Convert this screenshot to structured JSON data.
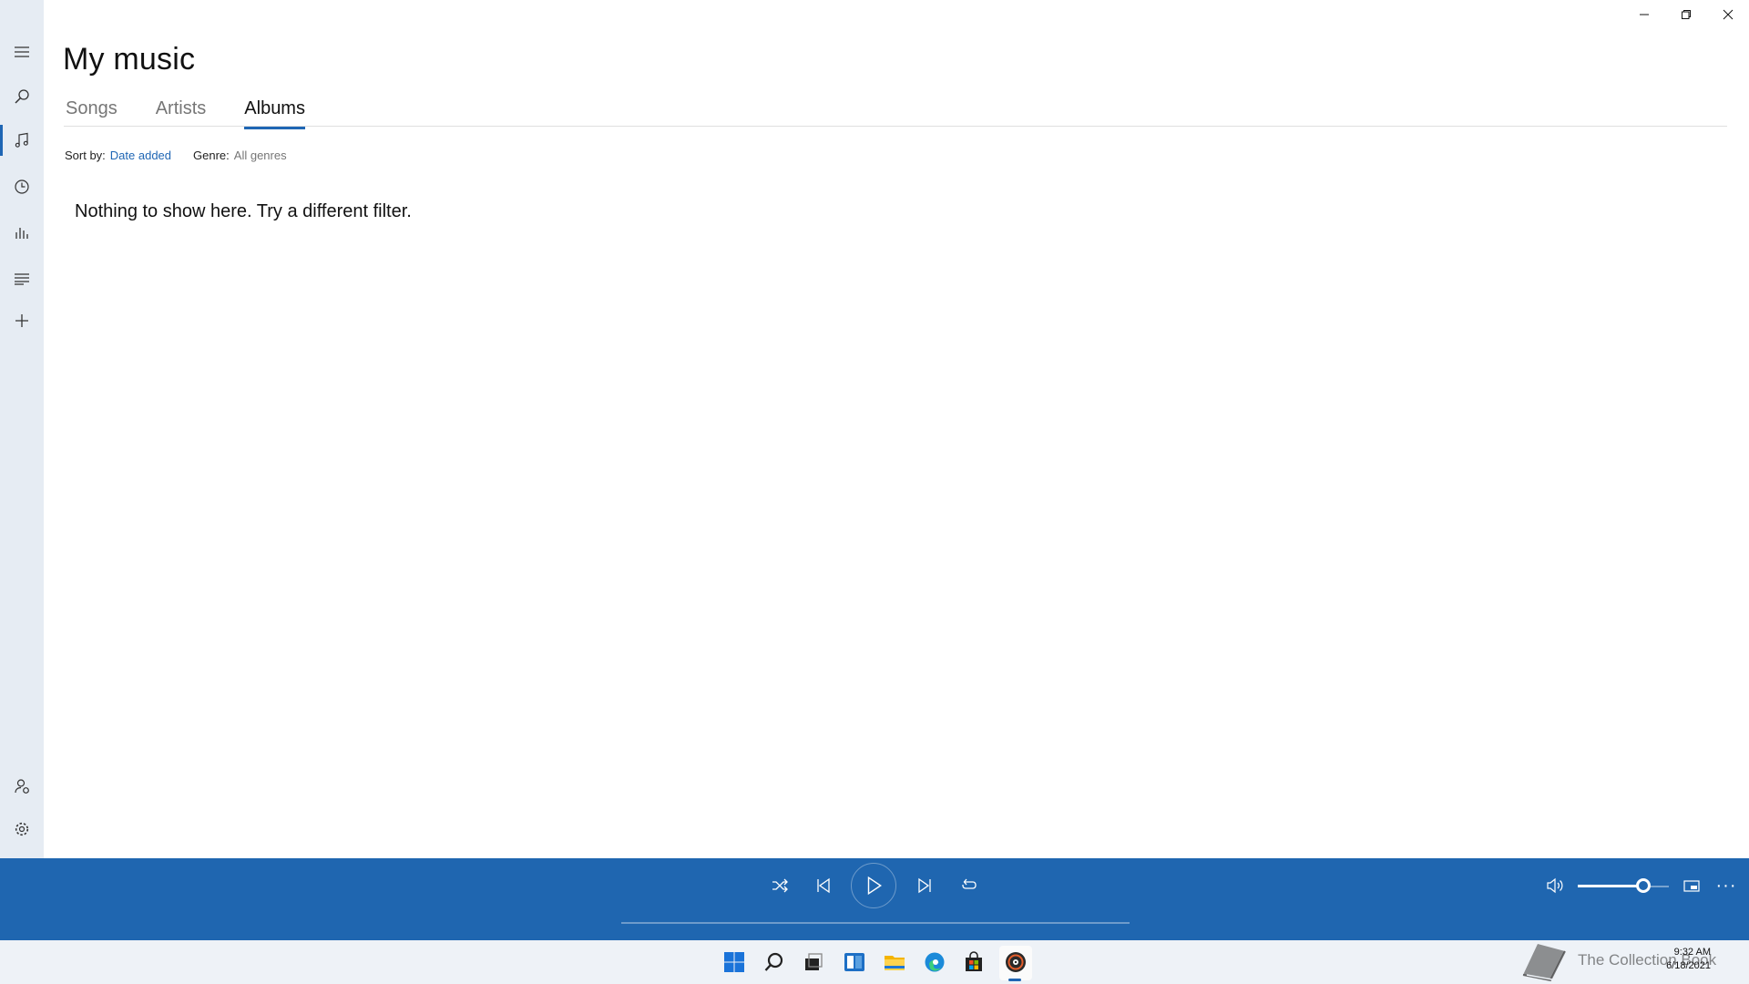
{
  "app": {
    "title": "My music",
    "tabs": [
      {
        "label": "Songs",
        "active": false
      },
      {
        "label": "Artists",
        "active": false
      },
      {
        "label": "Albums",
        "active": true
      }
    ],
    "filters": {
      "sort_label": "Sort by:",
      "sort_value": "Date added",
      "genre_label": "Genre:",
      "genre_value": "All genres"
    },
    "empty_message": "Nothing to show here. Try a different filter."
  },
  "nav": {
    "items": [
      {
        "name": "menu-icon"
      },
      {
        "name": "search-icon"
      },
      {
        "name": "music-note-icon",
        "selected": true
      },
      {
        "name": "recent-clock-icon"
      },
      {
        "name": "now-playing-bars-icon"
      },
      {
        "name": "playlists-icon"
      },
      {
        "name": "add-icon"
      },
      {
        "name": "account-icon"
      },
      {
        "name": "settings-gear-icon"
      }
    ]
  },
  "player": {
    "volume_level": 0.72,
    "controls": [
      "shuffle-icon",
      "previous-icon",
      "play-icon",
      "next-icon",
      "repeat-icon",
      "volume-icon",
      "mini-player-icon",
      "more-icon"
    ],
    "more_label": "···"
  },
  "taskbar": {
    "apps": [
      "start-icon",
      "search-icon",
      "task-view-icon",
      "widgets-icon",
      "file-explorer-icon",
      "edge-icon",
      "store-icon",
      "groove-music-icon"
    ],
    "time": "9:32 AM",
    "date": "6/18/2021"
  },
  "watermark": {
    "text": "The Collection Book"
  },
  "colors": {
    "accent": "#1f66b4",
    "player_bg": "#1f66b0",
    "rail_bg": "#e6ecf3",
    "taskbar_bg": "#eef2f7"
  }
}
